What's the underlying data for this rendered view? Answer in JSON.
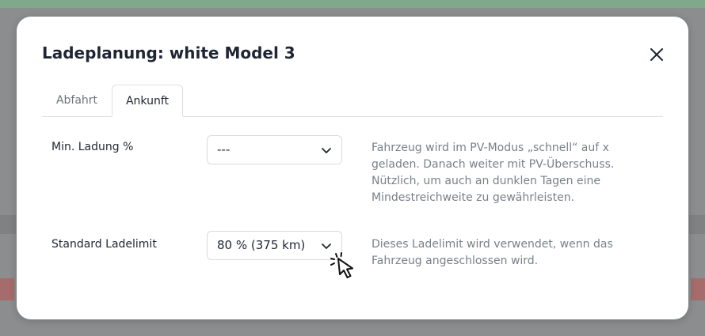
{
  "dialog": {
    "title": "Ladeplanung: white Model 3",
    "close_icon": "close-icon"
  },
  "tabs": [
    {
      "label": "Abfahrt",
      "active": false
    },
    {
      "label": "Ankunft",
      "active": true
    }
  ],
  "settings": {
    "min_charge": {
      "label": "Min. Ladung %",
      "value": "---",
      "help": "Fahrzeug wird im PV-Modus „schnell“ auf x geladen. Danach weiter mit PV-Überschuss. Nützlich, um auch an dunklen Tagen eine Mindestreichweite zu gewährleisten."
    },
    "default_limit": {
      "label": "Standard Ladelimit",
      "value": "80 % (375 km)",
      "help": "Dieses Ladelimit wird verwendet, wenn das Fahrzeug angeschlossen wird."
    }
  },
  "icons": {
    "dropdown": "chevron-down-icon",
    "pointer": "pointer-cursor-icon"
  },
  "colors": {
    "title": "#1f2533",
    "muted_text": "#7a8088",
    "border": "#d7dbe0",
    "backdrop": "#8b8d8f"
  }
}
